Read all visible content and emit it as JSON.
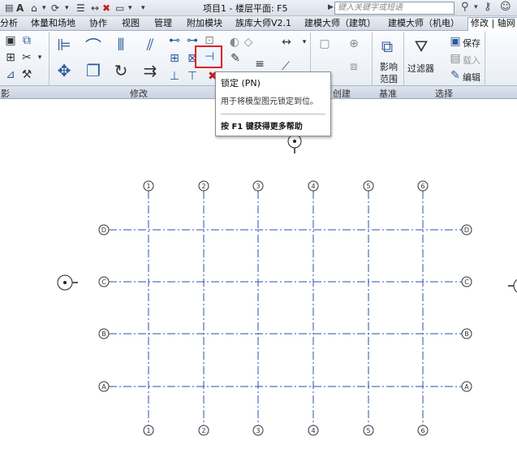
{
  "window": {
    "title": "项目1 - 楼层平面: F5",
    "search_placeholder": "键入关键字或短语"
  },
  "quick_access": {
    "app_letter": "A"
  },
  "tabs": [
    {
      "label": "分析"
    },
    {
      "label": "体量和场地"
    },
    {
      "label": "协作"
    },
    {
      "label": "视图"
    },
    {
      "label": "管理"
    },
    {
      "label": "附加模块"
    },
    {
      "label": "族库大师V2.1"
    },
    {
      "label": "建模大师（建筑）"
    },
    {
      "label": "建模大师（机电）"
    },
    {
      "label": "修改 | 轴网"
    }
  ],
  "ribbon": {
    "panels": {
      "left_partial": "影",
      "modify": "修改",
      "create": "创建",
      "datum": "基准",
      "selection": "选择"
    },
    "datum_buttons": {
      "scope_box_line1": "影响",
      "scope_box_line2": "范围"
    },
    "selection_buttons": {
      "filter": "过滤器",
      "save": "保存",
      "load": "载入",
      "edit": "编辑"
    }
  },
  "tooltip": {
    "title": "锁定 (PN)",
    "description": "用于将模型图元锁定到位。",
    "help": "按 F1 键获得更多帮助"
  },
  "grid": {
    "vertical_labels": [
      "1",
      "2",
      "3",
      "4",
      "5",
      "6"
    ],
    "horizontal_labels": [
      "D",
      "C",
      "B",
      "A"
    ],
    "line_color": "#2a4fb0"
  },
  "accent": {
    "highlight_border": "#e02020"
  }
}
